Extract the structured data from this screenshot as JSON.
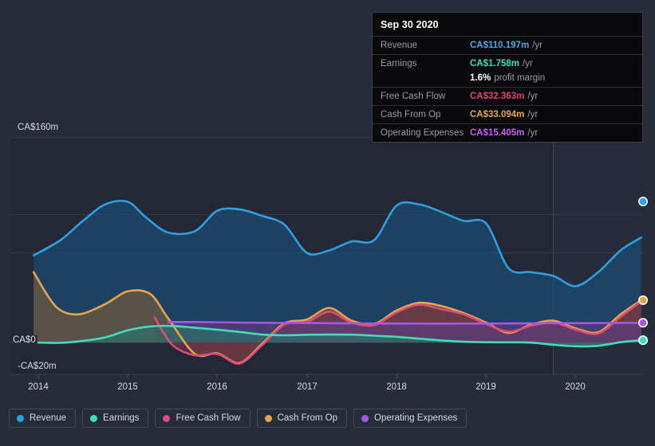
{
  "chart_data": {
    "type": "area",
    "title": "",
    "xlabel": "",
    "ylabel": "",
    "currency": "CA$",
    "grid": true,
    "legend_position": "bottom-left",
    "xlim": [
      2013.7,
      2020.75
    ],
    "ylim": [
      -20,
      160
    ],
    "y_ticks": [
      {
        "label": "CA$160m",
        "value": 160
      },
      {
        "label": "CA$0",
        "value": 0
      },
      {
        "label": "-CA$20m",
        "value": -20
      }
    ],
    "x_ticks": [
      "2014",
      "2015",
      "2016",
      "2017",
      "2018",
      "2019",
      "2020"
    ],
    "forecast_region_start": "2019.75",
    "series": [
      {
        "name": "Revenue",
        "color": "#2e9fe0",
        "fill": "#1d4c73",
        "x": [
          2013.95,
          2014.25,
          2014.5,
          2014.75,
          2015.0,
          2015.2,
          2015.45,
          2015.75,
          2016.0,
          2016.25,
          2016.5,
          2016.75,
          2017.0,
          2017.25,
          2017.5,
          2017.75,
          2018.0,
          2018.25,
          2018.5,
          2018.75,
          2019.0,
          2019.25,
          2019.5,
          2019.75,
          2020.0,
          2020.25,
          2020.5,
          2020.73
        ],
        "values": [
          68,
          80,
          95,
          108,
          110,
          98,
          86,
          87,
          103,
          104,
          99,
          92,
          70,
          72,
          79,
          80,
          107,
          108,
          102,
          95,
          93,
          58,
          55,
          52,
          44,
          55,
          72,
          82
        ]
      },
      {
        "name": "Earnings",
        "color": "#3fddb9",
        "fill": "#2f6f6a",
        "x": [
          2013.95,
          2014.25,
          2014.5,
          2014.75,
          2015.0,
          2015.25,
          2015.5,
          2015.75,
          2016.0,
          2016.25,
          2016.5,
          2016.75,
          2017.0,
          2017.25,
          2017.5,
          2017.75,
          2018.0,
          2018.25,
          2018.5,
          2018.75,
          2019.0,
          2019.25,
          2019.5,
          2019.75,
          2020.0,
          2020.25,
          2020.5,
          2020.73
        ],
        "values": [
          0.0,
          -0.3,
          1.2,
          4.0,
          9.5,
          12.5,
          12.9,
          11.5,
          10.0,
          8.2,
          6.2,
          5.6,
          6.0,
          6.2,
          6.1,
          5.3,
          4.4,
          3.0,
          1.6,
          0.6,
          0.2,
          0.1,
          -0.1,
          -1.8,
          -3.0,
          -2.6,
          0.2,
          1.758
        ]
      },
      {
        "name": "Free Cash Flow",
        "color": "#da4d79",
        "fill": "#6d3146",
        "x": [
          2015.3,
          2015.5,
          2015.75,
          2016.0,
          2016.25,
          2016.5,
          2016.75,
          2017.0,
          2017.25,
          2017.5,
          2017.75,
          2018.0,
          2018.25,
          2018.5,
          2018.75,
          2019.0,
          2019.25,
          2019.5,
          2019.75,
          2020.0,
          2020.25,
          2020.5,
          2020.73
        ],
        "values": [
          19.5,
          -2.0,
          -10.0,
          -9.0,
          -16.5,
          -2.0,
          14.0,
          16.0,
          24.0,
          15.5,
          13.5,
          23.5,
          29.5,
          26.0,
          22.0,
          14.5,
          8.5,
          13.0,
          15.5,
          10.0,
          7.0,
          20.0,
          32.363
        ]
      },
      {
        "name": "Cash From Op",
        "color": "#e8a44a",
        "fill": "#6d5a43",
        "x": [
          2013.95,
          2014.2,
          2014.45,
          2014.75,
          2015.0,
          2015.25,
          2015.45,
          2015.75,
          2016.0,
          2016.25,
          2016.5,
          2016.75,
          2017.0,
          2017.25,
          2017.5,
          2017.75,
          2018.0,
          2018.25,
          2018.5,
          2018.75,
          2019.0,
          2019.25,
          2019.5,
          2019.75,
          2020.0,
          2020.25,
          2020.5,
          2020.73
        ],
        "values": [
          55,
          28,
          22,
          30,
          40,
          38,
          19,
          -9,
          -8.5,
          -16,
          -1,
          15,
          18,
          27,
          17,
          14.5,
          25,
          31,
          28.5,
          23,
          15.5,
          7.5,
          14,
          17,
          11,
          8,
          22,
          33.094
        ]
      },
      {
        "name": "Operating Expenses",
        "color": "#a956e8",
        "fill": "#5a3d7a",
        "x": [
          2015.45,
          2015.75,
          2016.0,
          2016.5,
          2017.0,
          2017.5,
          2018.0,
          2018.5,
          2019.0,
          2019.5,
          2020.0,
          2020.5,
          2020.73
        ],
        "values": [
          16.0,
          16.0,
          15.8,
          15.4,
          15.2,
          14.9,
          14.8,
          14.7,
          14.8,
          15.0,
          15.1,
          15.3,
          15.405
        ]
      }
    ],
    "endpoints": [
      {
        "name": "Revenue",
        "value": 110.197
      },
      {
        "name": "Cash From Op",
        "value": 33.094
      },
      {
        "name": "Operating Expenses",
        "value": 15.405
      },
      {
        "name": "Earnings",
        "value": 1.758
      }
    ]
  },
  "tooltip": {
    "date": "Sep 30 2020",
    "rows": [
      {
        "label": "Revenue",
        "value": "CA$110.197m",
        "unit": "/yr",
        "color": "#4ea8e8"
      },
      {
        "label": "Earnings",
        "value": "CA$1.758m",
        "unit": "/yr",
        "color": "#3fddb9"
      },
      {
        "label": "",
        "value": "1.6%",
        "unit": "",
        "sub": "profit margin",
        "color": "#ffffff"
      },
      {
        "label": "Free Cash Flow",
        "value": "CA$32.363m",
        "unit": "/yr",
        "color": "#e0446f"
      },
      {
        "label": "Cash From Op",
        "value": "CA$33.094m",
        "unit": "/yr",
        "color": "#e8a44a"
      },
      {
        "label": "Operating Expenses",
        "value": "CA$15.405m",
        "unit": "/yr",
        "color": "#c35ef5"
      }
    ]
  },
  "legend": {
    "items": [
      {
        "label": "Revenue",
        "color": "#2e9fe0"
      },
      {
        "label": "Earnings",
        "color": "#3fddb9"
      },
      {
        "label": "Free Cash Flow",
        "color": "#da4d79"
      },
      {
        "label": "Cash From Op",
        "color": "#e8a44a"
      },
      {
        "label": "Operating Expenses",
        "color": "#a956e8"
      }
    ]
  }
}
